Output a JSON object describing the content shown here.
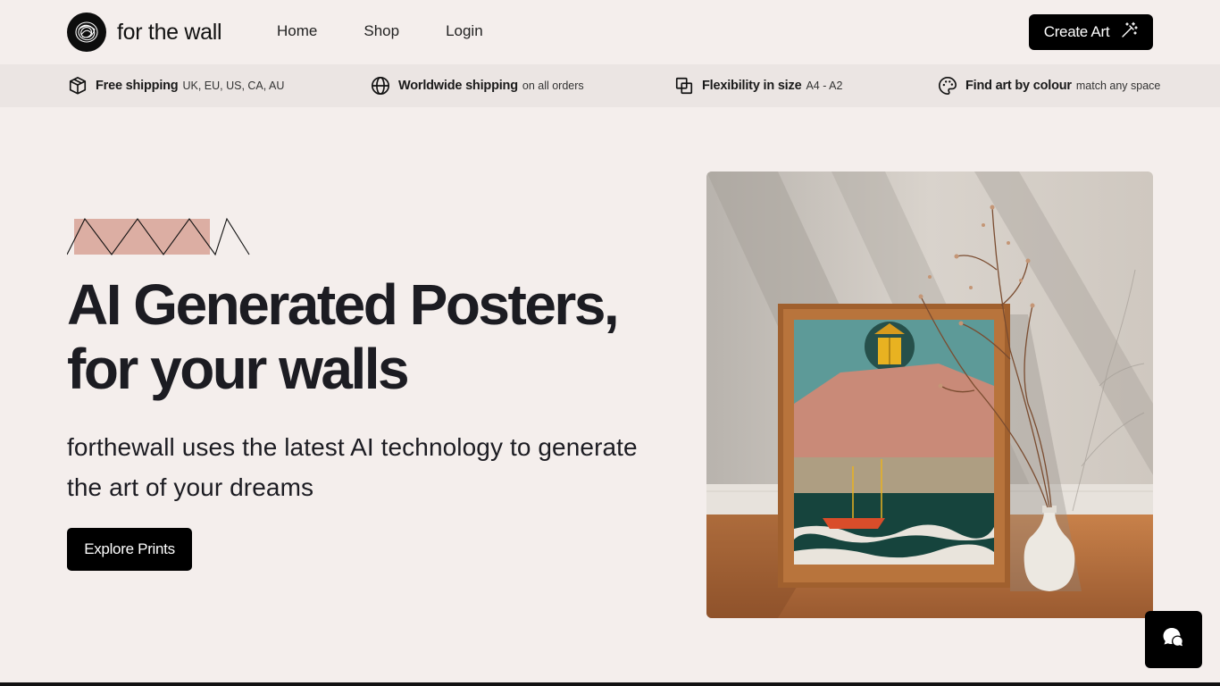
{
  "brand": {
    "name": "for the wall"
  },
  "nav": {
    "items": [
      "Home",
      "Shop",
      "Login"
    ]
  },
  "header": {
    "create_label": "Create Art"
  },
  "features": [
    {
      "icon": "box-icon",
      "strong": "Free shipping",
      "light": "UK, EU, US, CA, AU"
    },
    {
      "icon": "globe-icon",
      "strong": "Worldwide shipping",
      "light": "on all orders"
    },
    {
      "icon": "resize-icon",
      "strong": "Flexibility in size",
      "light": "A4 - A2"
    },
    {
      "icon": "palette-icon",
      "strong": "Find art by colour",
      "light": "match any space"
    }
  ],
  "hero": {
    "title": "AI Generated Posters, for your walls",
    "subtitle": "forthewall uses the latest AI technology to generate the art of your dreams",
    "cta_label": "Explore Prints"
  },
  "colors": {
    "background": "#f4eeec",
    "feature_bar": "#ebe5e3",
    "accent_pink": "#dcaea3",
    "button": "#000000"
  }
}
